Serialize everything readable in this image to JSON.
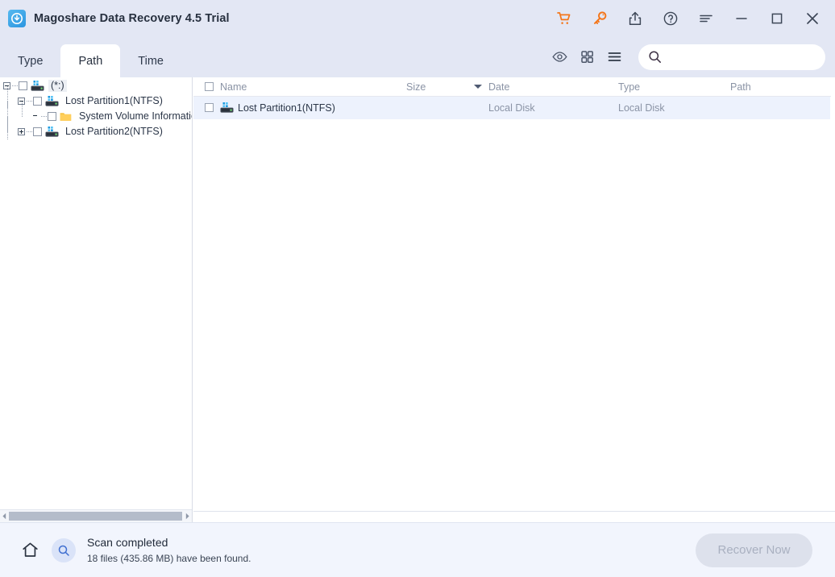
{
  "window": {
    "title": "Magoshare Data Recovery 4.5 Trial",
    "logo_icon": "app-logo-icon",
    "controls": [
      {
        "name": "cart-icon",
        "label": "Buy Now",
        "color": "#f4761a"
      },
      {
        "name": "key-icon",
        "label": "Register",
        "color": "#f4761a"
      },
      {
        "name": "share-icon",
        "label": "Share",
        "color": "#3d4757"
      },
      {
        "name": "help-icon",
        "label": "Help",
        "color": "#3d4757"
      },
      {
        "name": "menu-icon",
        "label": "Menu",
        "color": "#3d4757"
      },
      {
        "name": "minimize-icon",
        "label": "Minimize",
        "color": "#3d4757"
      },
      {
        "name": "maximize-icon",
        "label": "Maximize",
        "color": "#3d4757"
      },
      {
        "name": "close-icon",
        "label": "Close",
        "color": "#3d4757"
      }
    ]
  },
  "toolbar": {
    "tabs": [
      {
        "label": "Type",
        "active": false
      },
      {
        "label": "Path",
        "active": true
      },
      {
        "label": "Time",
        "active": false
      }
    ],
    "view_icons": [
      {
        "name": "preview-eye-icon",
        "label": "Preview"
      },
      {
        "name": "grid-view-icon",
        "label": "Grid View"
      },
      {
        "name": "list-view-icon",
        "label": "List View"
      }
    ],
    "search": {
      "value": "",
      "placeholder": "",
      "icon": "search-icon"
    }
  },
  "tree": {
    "nodes": [
      {
        "expander": "minus",
        "checked": false,
        "icon": "disk-icon",
        "label": "(*:)",
        "selected": true,
        "depth": 0
      },
      {
        "expander": "minus",
        "checked": false,
        "icon": "disk-icon",
        "label": "Lost Partition1(NTFS)",
        "selected": false,
        "depth": 1
      },
      {
        "expander": "none",
        "checked": false,
        "icon": "folder-icon",
        "label": "System Volume Information",
        "selected": false,
        "depth": 2
      },
      {
        "expander": "plus",
        "checked": false,
        "icon": "disk-icon",
        "label": "Lost Partition2(NTFS)",
        "selected": false,
        "depth": 1
      }
    ],
    "scrollbar": {
      "left_arrow": "scroll-left-arrow",
      "right_arrow": "scroll-right-arrow"
    }
  },
  "filelist": {
    "columns": [
      {
        "key": "name",
        "label": "Name",
        "sorted": false
      },
      {
        "key": "size",
        "label": "Size",
        "sorted": true,
        "sort_dir": "desc"
      },
      {
        "key": "date",
        "label": "Date",
        "sorted": false
      },
      {
        "key": "type",
        "label": "Type",
        "sorted": false
      },
      {
        "key": "path",
        "label": "Path",
        "sorted": false
      }
    ],
    "rows": [
      {
        "checked": false,
        "icon": "disk-icon",
        "name": "Lost Partition1(NTFS)",
        "size": "",
        "date": "Local Disk",
        "type": "Local Disk",
        "path": "",
        "selected": true
      }
    ]
  },
  "statusbar": {
    "home_icon": "home-icon",
    "scan_icon": "scan-search-icon",
    "title": "Scan completed",
    "subtitle": "18 files (435.86 MB) have been found.",
    "recover_label": "Recover Now",
    "recover_enabled": false
  },
  "colors": {
    "titlebar_bg": "#e3e7f4",
    "accent_orange": "#f4761a",
    "row_selected": "#edf2fd",
    "statusbar_bg": "#f2f5fd",
    "text_primary": "#2b3648",
    "text_muted": "#8a93a5"
  }
}
